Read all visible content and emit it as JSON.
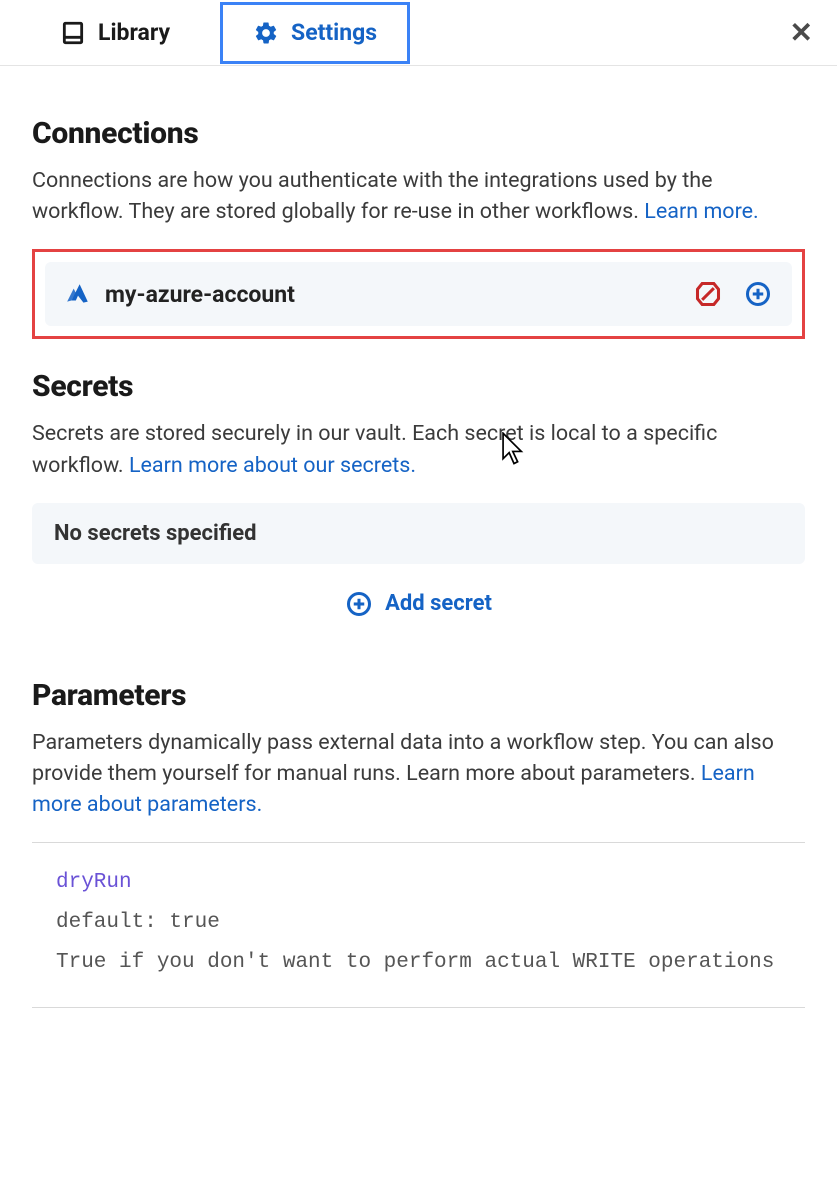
{
  "tabs": {
    "library": "Library",
    "settings": "Settings"
  },
  "connections": {
    "heading": "Connections",
    "desc_pre": "Connections are how you authenticate with the integrations used by the workflow. They are stored globally for re-use in other workflows. ",
    "learn_more": "Learn more.",
    "item": {
      "name": "my-azure-account"
    }
  },
  "secrets": {
    "heading": "Secrets",
    "desc_pre": "Secrets are stored securely in our vault. Each secret is local to a specific workflow. ",
    "learn_more": "Learn more about our secrets.",
    "empty": "No secrets specified",
    "add_label": "Add secret"
  },
  "parameters": {
    "heading": "Parameters",
    "desc_pre": "Parameters dynamically pass external data into a workflow step. You can also provide them yourself for manual runs. Learn more about parameters. ",
    "learn_more": "Learn more about parameters.",
    "param1": {
      "name": "dryRun",
      "default_line": "default: true",
      "desc": "True if you don't want to perform actual WRITE operations"
    }
  }
}
